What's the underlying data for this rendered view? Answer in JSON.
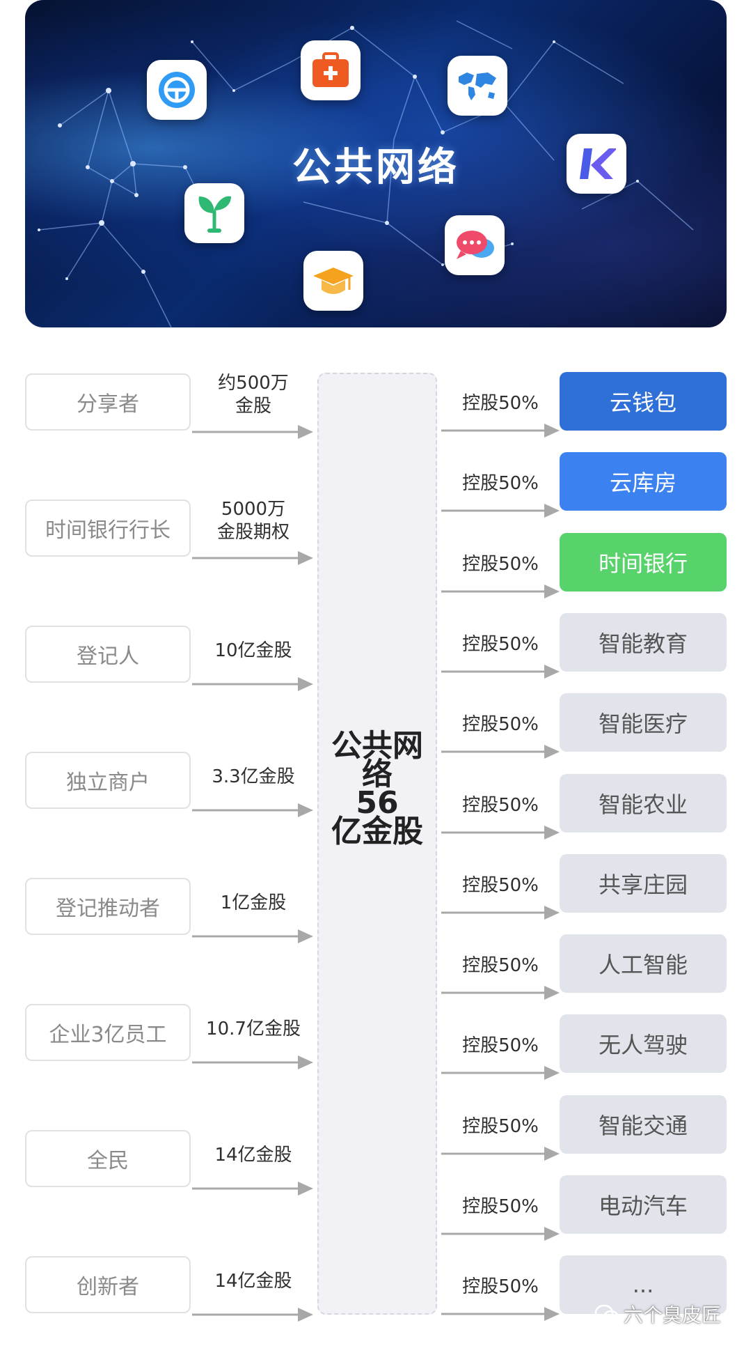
{
  "banner": {
    "title": "公共网络",
    "apps": [
      {
        "name": "steering-wheel-icon",
        "color": "#2f9bf4"
      },
      {
        "name": "medical-kit-icon",
        "color": "#ef5a22"
      },
      {
        "name": "world-map-icon",
        "color": "#2f86e0"
      },
      {
        "name": "k-logo-icon",
        "color": "#4a5be8"
      },
      {
        "name": "sprout-icon",
        "color": "#2eb872"
      },
      {
        "name": "graduation-cap-icon",
        "color": "#f5a21f"
      },
      {
        "name": "chat-bubble-icon",
        "color": "#ef4a6a"
      }
    ]
  },
  "diagram": {
    "center_label": "公共网络\n56\n亿金股",
    "holders": [
      {
        "name": "分享者",
        "amount": "约500万\n金股"
      },
      {
        "name": "时间银行行长",
        "amount": "5000万\n金股期权"
      },
      {
        "name": "登记人",
        "amount": "10亿金股"
      },
      {
        "name": "独立商户",
        "amount": "3.3亿金股"
      },
      {
        "name": "登记推动者",
        "amount": "1亿金股"
      },
      {
        "name": "企业3亿员工",
        "amount": "10.7亿金股"
      },
      {
        "name": "全民",
        "amount": "14亿金股"
      },
      {
        "name": "创新者",
        "amount": "14亿金股"
      }
    ],
    "subsidiaries": [
      {
        "name": "云钱包",
        "ctrl": "控股50%",
        "style": "blue1"
      },
      {
        "name": "云库房",
        "ctrl": "控股50%",
        "style": "blue2"
      },
      {
        "name": "时间银行",
        "ctrl": "控股50%",
        "style": "green"
      },
      {
        "name": "智能教育",
        "ctrl": "控股50%",
        "style": "gray"
      },
      {
        "name": "智能医疗",
        "ctrl": "控股50%",
        "style": "gray"
      },
      {
        "name": "智能农业",
        "ctrl": "控股50%",
        "style": "gray"
      },
      {
        "name": "共享庄园",
        "ctrl": "控股50%",
        "style": "gray"
      },
      {
        "name": "人工智能",
        "ctrl": "控股50%",
        "style": "gray"
      },
      {
        "name": "无人驾驶",
        "ctrl": "控股50%",
        "style": "gray"
      },
      {
        "name": "智能交通",
        "ctrl": "控股50%",
        "style": "gray"
      },
      {
        "name": "电动汽车",
        "ctrl": "控股50%",
        "style": "gray"
      },
      {
        "name": "...",
        "ctrl": "控股50%",
        "style": "gray"
      }
    ]
  },
  "watermark": "六个臭皮匠",
  "colors": {
    "arrow": "#a8a8a8",
    "box_border": "#e1e1e1",
    "center_fill": "#f1f1f6",
    "blue1": "#2e6fd8",
    "blue2": "#3b82f0",
    "green": "#58d36c",
    "gray": "#e2e4ec"
  }
}
